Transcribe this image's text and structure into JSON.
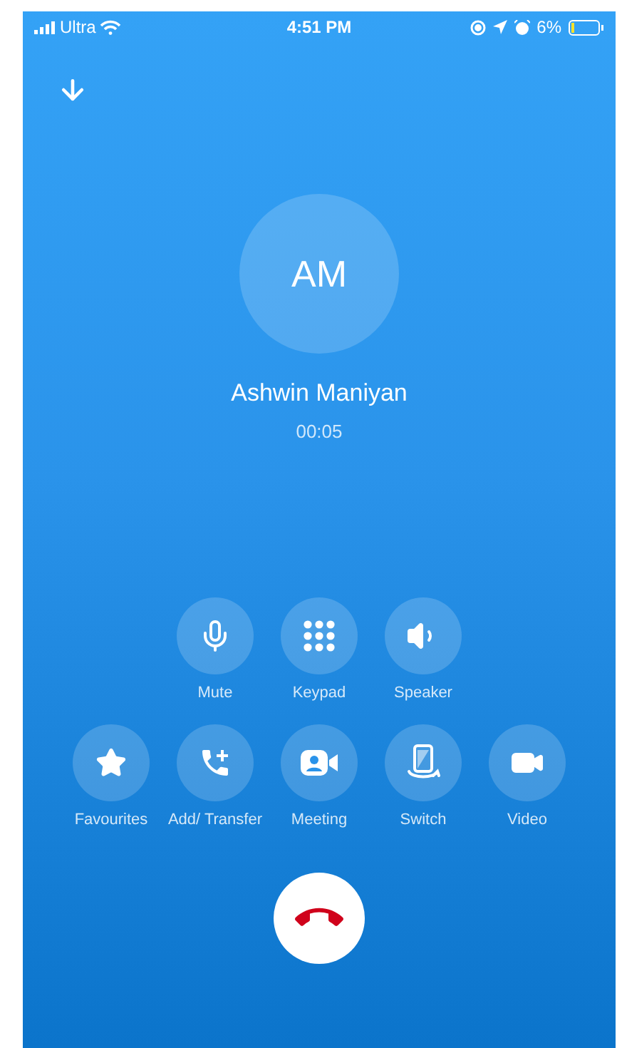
{
  "status_bar": {
    "carrier": "Ultra",
    "time": "4:51 PM",
    "battery": "6%"
  },
  "caller": {
    "initials": "AM",
    "name": "Ashwin Maniyan",
    "duration": "00:05"
  },
  "controls": [
    {
      "kind": "mute",
      "label": "Mute"
    },
    {
      "kind": "keypad",
      "label": "Keypad"
    },
    {
      "kind": "speaker",
      "label": "Speaker"
    }
  ],
  "actions": [
    {
      "kind": "favourites",
      "label": "Favourites"
    },
    {
      "kind": "transfer",
      "label": "Add/ Transfer"
    },
    {
      "kind": "meeting",
      "label": "Meeting"
    },
    {
      "kind": "switch",
      "label": "Switch"
    },
    {
      "kind": "video",
      "label": "Video"
    }
  ]
}
